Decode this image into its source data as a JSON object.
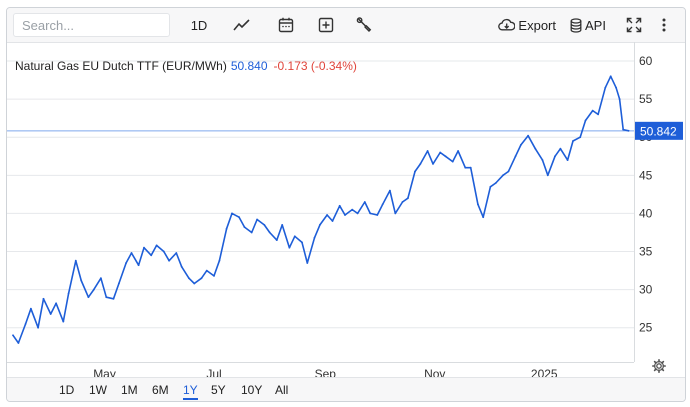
{
  "toolbar": {
    "search_placeholder": "Search...",
    "interval_label": "1D",
    "export_label": "Export",
    "api_label": "API",
    "icons": [
      "line-chart-icon",
      "calendar-icon",
      "add-indicator-icon",
      "tools-icon",
      "download-cloud-icon",
      "database-icon",
      "fullscreen-icon",
      "more-vertical-icon"
    ]
  },
  "legend": {
    "name": "Natural Gas EU Dutch TTF (EUR/MWh)",
    "last": "50.840",
    "change": "-0.173 (-0.34%)"
  },
  "price_tag": "50.842",
  "range_buttons": [
    "1D",
    "1W",
    "1M",
    "6M",
    "1Y",
    "5Y",
    "10Y",
    "All"
  ],
  "active_range": "1Y",
  "colors": {
    "line": "#1e5ed8",
    "negative": "#e0453b",
    "grid": "#e6e8eb",
    "price_line": "#7fa9ee"
  },
  "chart_data": {
    "type": "line",
    "series": [
      {
        "name": "Natural Gas EU Dutch TTF (EUR/MWh)",
        "x": [
          "2024-03-11",
          "2024-03-14",
          "2024-03-18",
          "2024-03-21",
          "2024-03-25",
          "2024-03-28",
          "2024-04-01",
          "2024-04-04",
          "2024-04-08",
          "2024-04-11",
          "2024-04-15",
          "2024-04-18",
          "2024-04-22",
          "2024-04-25",
          "2024-04-29",
          "2024-05-02",
          "2024-05-06",
          "2024-05-09",
          "2024-05-13",
          "2024-05-16",
          "2024-05-20",
          "2024-05-23",
          "2024-05-27",
          "2024-05-30",
          "2024-06-03",
          "2024-06-06",
          "2024-06-10",
          "2024-06-13",
          "2024-06-17",
          "2024-06-20",
          "2024-06-24",
          "2024-06-27",
          "2024-07-01",
          "2024-07-04",
          "2024-07-08",
          "2024-07-11",
          "2024-07-15",
          "2024-07-18",
          "2024-07-22",
          "2024-07-25",
          "2024-07-29",
          "2024-08-01",
          "2024-08-05",
          "2024-08-08",
          "2024-08-12",
          "2024-08-15",
          "2024-08-19",
          "2024-08-22",
          "2024-08-26",
          "2024-08-29",
          "2024-09-02",
          "2024-09-05",
          "2024-09-09",
          "2024-09-12",
          "2024-09-16",
          "2024-09-19",
          "2024-09-23",
          "2024-09-26",
          "2024-09-30",
          "2024-10-03",
          "2024-10-07",
          "2024-10-10",
          "2024-10-14",
          "2024-10-17",
          "2024-10-21",
          "2024-10-24",
          "2024-10-28",
          "2024-10-31",
          "2024-11-04",
          "2024-11-07",
          "2024-11-11",
          "2024-11-14",
          "2024-11-18",
          "2024-11-21",
          "2024-11-25",
          "2024-11-28",
          "2024-12-02",
          "2024-12-05",
          "2024-12-09",
          "2024-12-12",
          "2024-12-16",
          "2024-12-19",
          "2024-12-23",
          "2024-12-27",
          "2024-12-31",
          "2025-01-03",
          "2025-01-07",
          "2025-01-10",
          "2025-01-14",
          "2025-01-17",
          "2025-01-21",
          "2025-01-24",
          "2025-01-28",
          "2025-01-31",
          "2025-02-04",
          "2025-02-07",
          "2025-02-10",
          "2025-02-12",
          "2025-02-14",
          "2025-02-17"
        ],
        "y": [
          24.0,
          23.0,
          25.5,
          27.5,
          25.0,
          28.8,
          26.8,
          28.2,
          25.8,
          29.5,
          33.8,
          31.2,
          29.0,
          30.0,
          31.5,
          29.0,
          28.8,
          30.8,
          33.5,
          34.8,
          33.2,
          35.5,
          34.5,
          35.8,
          35.0,
          33.8,
          34.8,
          33.0,
          31.5,
          30.8,
          31.5,
          32.5,
          31.8,
          33.8,
          38.0,
          40.0,
          39.5,
          38.2,
          37.5,
          39.2,
          38.5,
          37.5,
          36.5,
          38.5,
          35.5,
          37.0,
          36.2,
          33.5,
          36.8,
          38.5,
          39.8,
          39.0,
          41.0,
          39.8,
          40.5,
          40.0,
          41.5,
          40.0,
          39.8,
          41.2,
          43.0,
          40.0,
          41.5,
          42.0,
          45.5,
          46.5,
          48.2,
          46.5,
          48.0,
          47.5,
          46.8,
          48.2,
          46.0,
          46.0,
          41.2,
          39.5,
          43.5,
          44.0,
          45.0,
          45.5,
          47.5,
          49.0,
          50.2,
          48.5,
          47.0,
          45.0,
          47.5,
          48.5,
          47.0,
          49.5,
          50.0,
          52.2,
          53.5,
          53.0,
          56.5,
          58.0,
          56.5,
          55.0,
          51.0,
          50.84
        ]
      }
    ],
    "x_ticks": [
      "May",
      "Jul",
      "Sep",
      "Nov",
      "2025"
    ],
    "y_ticks": [
      25,
      30,
      35,
      40,
      45,
      50,
      55,
      60
    ],
    "ylim": [
      20.5,
      62.5
    ],
    "xlim": [
      "2024-03-11",
      "2025-02-20"
    ],
    "grid": true,
    "last_value_line": 50.842,
    "y_axis_side": "right"
  }
}
